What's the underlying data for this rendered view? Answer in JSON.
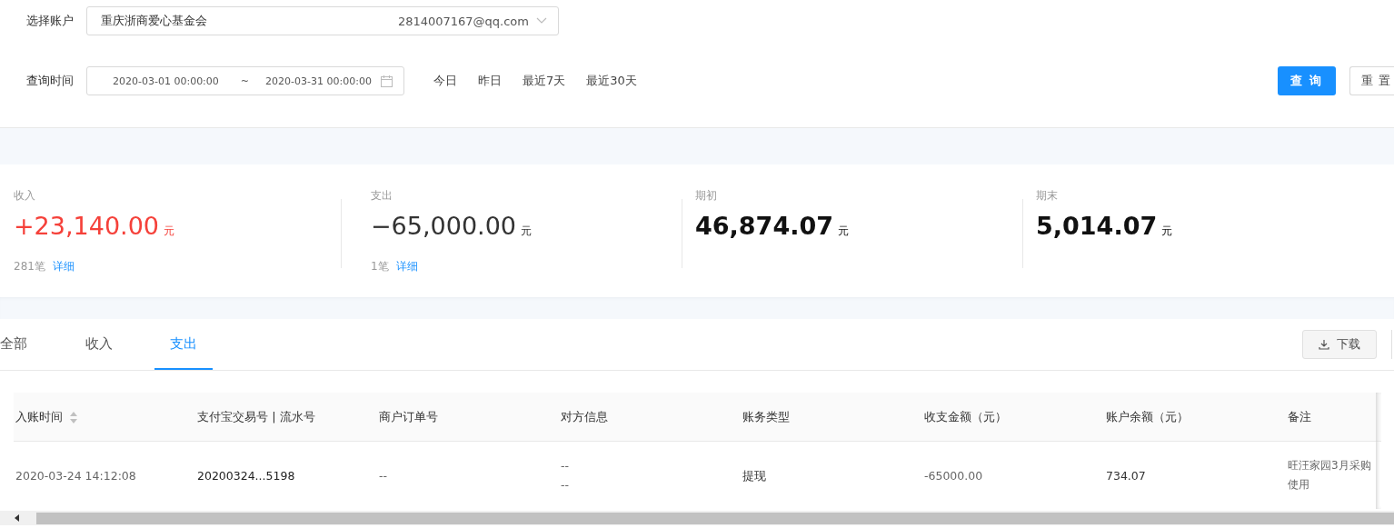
{
  "filters": {
    "account_label": "选择账户",
    "account_name": "重庆浙商爱心基金会",
    "account_email": "2814007167@qq.com",
    "time_label": "查询时间",
    "start": "2020-03-01 00:00:00",
    "separator": "~",
    "end": "2020-03-31 00:00:00",
    "quick_ranges": [
      "今日",
      "昨日",
      "最近7天",
      "最近30天"
    ],
    "buttons": [
      {
        "label": "查 询",
        "kind": "primary"
      },
      {
        "label": "重 置",
        "kind": "default"
      }
    ]
  },
  "summary": [
    {
      "label": "收入",
      "amount": "+23,140.00",
      "unit": "元",
      "kind": "income",
      "count": "281笔",
      "link": "详细"
    },
    {
      "label": "支出",
      "amount": "−65,000.00",
      "unit": "元",
      "kind": "plain",
      "count": "1笔",
      "link": "详细"
    },
    {
      "label": "期初",
      "amount": "46,874.07",
      "unit": "元",
      "kind": "strong"
    },
    {
      "label": "期末",
      "amount": "5,014.07",
      "unit": "元",
      "kind": "strong"
    }
  ],
  "tabs": [
    {
      "label": "全部",
      "selected": false
    },
    {
      "label": "收入",
      "selected": false
    },
    {
      "label": "支出",
      "selected": true
    }
  ],
  "download_button": "下载",
  "table": {
    "columns": [
      {
        "label": "入账时间",
        "sortable": true
      },
      {
        "label": "支付宝交易号 | 流水号",
        "sortable": false
      },
      {
        "label": "商户订单号",
        "sortable": false
      },
      {
        "label": "对方信息",
        "sortable": false
      },
      {
        "label": "账务类型",
        "sortable": false
      },
      {
        "label": "收支金额（元）",
        "sortable": false
      },
      {
        "label": "账户余额（元）",
        "sortable": false
      },
      {
        "label": "备注",
        "sortable": false
      }
    ],
    "rows": [
      {
        "cells": [
          [
            "2020-03-24 14:12:08"
          ],
          [
            "20200324...5198"
          ],
          [
            "--"
          ],
          [
            "--",
            "--"
          ],
          [
            "提现"
          ],
          [
            "-65000.00"
          ],
          [
            "734.07"
          ],
          [
            "旺汪家园3月采购使用"
          ]
        ]
      }
    ]
  }
}
